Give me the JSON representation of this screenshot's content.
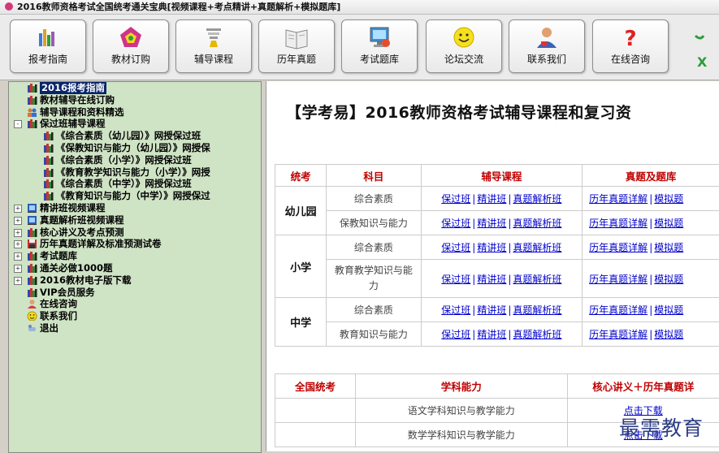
{
  "window": {
    "title": "2016教师资格考试全国统考通关宝典[视频课程+考点精讲+真题解析+模拟题库]"
  },
  "toolbar": [
    {
      "label": "报考指南",
      "icon": "chart-books-icon"
    },
    {
      "label": "教材订购",
      "icon": "pentagon-icon"
    },
    {
      "label": "辅导课程",
      "icon": "lamp-icon"
    },
    {
      "label": "历年真题",
      "icon": "book-icon"
    },
    {
      "label": "考试题库",
      "icon": "monitor-icon"
    },
    {
      "label": "论坛交流",
      "icon": "smiley-icon"
    },
    {
      "label": "联系我们",
      "icon": "person-icon"
    },
    {
      "label": "在线咨询",
      "icon": "question-icon"
    }
  ],
  "sidebar": {
    "items": [
      {
        "label": "2016报考指南",
        "level": 0,
        "icon": "books-icon",
        "expander": "",
        "selected": true
      },
      {
        "label": "教材辅导在线订购",
        "level": 0,
        "icon": "books-icon",
        "expander": ""
      },
      {
        "label": "辅导课程和资料精选",
        "level": 0,
        "icon": "people-icon",
        "expander": ""
      },
      {
        "label": "保过班辅导课程",
        "level": 0,
        "icon": "books-icon",
        "expander": "-"
      },
      {
        "label": "《综合素质（幼儿园）》网授保过班",
        "level": 1,
        "icon": "books-icon",
        "expander": ""
      },
      {
        "label": "《保教知识与能力（幼儿园）》网授保",
        "level": 1,
        "icon": "books-icon",
        "expander": ""
      },
      {
        "label": "《综合素质（小学）》网授保过班",
        "level": 1,
        "icon": "books-icon",
        "expander": ""
      },
      {
        "label": "《教育教学知识与能力（小学）》网授",
        "level": 1,
        "icon": "books-icon",
        "expander": ""
      },
      {
        "label": "《综合素质（中学）》网授保过班",
        "level": 1,
        "icon": "books-icon",
        "expander": ""
      },
      {
        "label": "《教育知识与能力（中学）》网授保过",
        "level": 1,
        "icon": "books-icon",
        "expander": ""
      },
      {
        "label": "精讲班视频课程",
        "level": 0,
        "icon": "film-icon",
        "expander": "+"
      },
      {
        "label": "真题解析班视频课程",
        "level": 0,
        "icon": "film-icon",
        "expander": "+"
      },
      {
        "label": "核心讲义及考点预测",
        "level": 0,
        "icon": "books-icon",
        "expander": "+"
      },
      {
        "label": "历年真题详解及标准预测试卷",
        "level": 0,
        "icon": "disk-icon",
        "expander": "+"
      },
      {
        "label": "考试题库",
        "level": 0,
        "icon": "books-icon",
        "expander": "+"
      },
      {
        "label": "通关必做1000题",
        "level": 0,
        "icon": "books-icon",
        "expander": "+"
      },
      {
        "label": "2016教材电子版下载",
        "level": 0,
        "icon": "books-icon",
        "expander": "+"
      },
      {
        "label": "VIP会员服务",
        "level": 0,
        "icon": "books-icon",
        "expander": ""
      },
      {
        "label": "在线咨询",
        "level": 0,
        "icon": "person-icon",
        "expander": ""
      },
      {
        "label": "联系我们",
        "level": 0,
        "icon": "smiley-icon",
        "expander": ""
      },
      {
        "label": "退出",
        "level": 0,
        "icon": "exit-icon",
        "expander": ""
      }
    ]
  },
  "main": {
    "title": "【学考易】2016教师资格考试辅导课程和复习资",
    "table1": {
      "headers": [
        "统考",
        "科目",
        "辅导课程",
        "真题及题库"
      ],
      "groups": [
        {
          "school": "幼儿园",
          "rows": [
            {
              "subject": "综合素质",
              "courses": [
                "保过班",
                "精讲班",
                "真题解析班"
              ],
              "exams": [
                "历年真题详解",
                "模拟题"
              ]
            },
            {
              "subject": "保教知识与能力",
              "courses": [
                "保过班",
                "精讲班",
                "真题解析班"
              ],
              "exams": [
                "历年真题详解",
                "模拟题"
              ]
            }
          ]
        },
        {
          "school": "小学",
          "rows": [
            {
              "subject": "综合素质",
              "courses": [
                "保过班",
                "精讲班",
                "真题解析班"
              ],
              "exams": [
                "历年真题详解",
                "模拟题"
              ]
            },
            {
              "subject": "教育教学知识与能力",
              "courses": [
                "保过班",
                "精讲班",
                "真题解析班"
              ],
              "exams": [
                "历年真题详解",
                "模拟题"
              ]
            }
          ]
        },
        {
          "school": "中学",
          "rows": [
            {
              "subject": "综合素质",
              "courses": [
                "保过班",
                "精讲班",
                "真题解析班"
              ],
              "exams": [
                "历年真题详解",
                "模拟题"
              ]
            },
            {
              "subject": "教育知识与能力",
              "courses": [
                "保过班",
                "精讲班",
                "真题解析班"
              ],
              "exams": [
                "历年真题详解",
                "模拟题"
              ]
            }
          ]
        }
      ]
    },
    "table2": {
      "headers": [
        "全国统考",
        "学科能力",
        "核心讲义＋历年真题详"
      ],
      "rows": [
        {
          "subject": "语文学科知识与教学能力",
          "action": "点击下载"
        },
        {
          "subject": "数学学科知识与教学能力",
          "action": "点击下载"
        }
      ]
    }
  },
  "watermark": "最需教育",
  "colors": {
    "header_red": "#c00000",
    "link_blue": "#0000cc",
    "sidebar_bg": "#cfe3c5",
    "selected_bg": "#0a246a"
  }
}
